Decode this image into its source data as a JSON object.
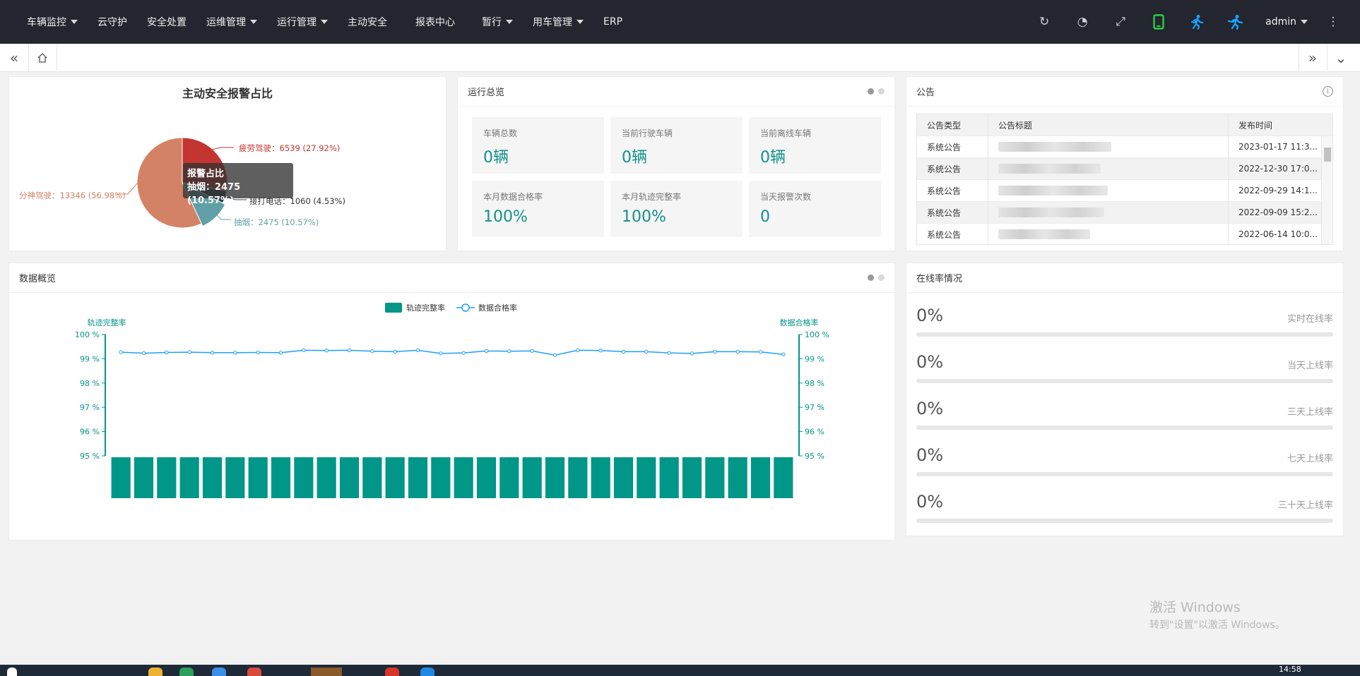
{
  "nav": {
    "menu": [
      {
        "label": "车辆监控",
        "dropdown": true
      },
      {
        "label": "云守护",
        "dropdown": false
      },
      {
        "label": "安全处置",
        "dropdown": false
      },
      {
        "label": "运维管理",
        "dropdown": true
      },
      {
        "label": "运行管理",
        "dropdown": true
      },
      {
        "label": "主动安全",
        "dropdown": false
      },
      {
        "label": "报表中心",
        "dropdown": false
      },
      {
        "label": "暂行",
        "dropdown": true
      },
      {
        "label": "用车管理",
        "dropdown": true
      },
      {
        "label": "ERP",
        "dropdown": false
      }
    ],
    "tools": [
      "refresh-icon",
      "dashboard-icon",
      "fullscreen-icon",
      "mobile-icon",
      "runner-icon",
      "runner-alt-icon"
    ],
    "user": "admin",
    "colors": {
      "bar": "#23262e",
      "mobile": "#2ecc40",
      "runner": "#1e9fff"
    }
  },
  "pie": {
    "title": "主动安全报警占比",
    "tooltip": {
      "title": "报警占比",
      "line": "抽烟：2475 (10.57%)"
    },
    "slices": [
      {
        "name": "疲劳驾驶",
        "value": 6539,
        "label": "疲劳驾驶：6539 (27.92%)",
        "color": "#c23531"
      },
      {
        "name": "接打电话",
        "value": 1060,
        "label": "接打电话：1060 (4.53%)",
        "color": "#2f4554"
      },
      {
        "name": "抽烟",
        "value": 2475,
        "label": "抽烟：2475 (10.57%)",
        "color": "#61a0a8"
      },
      {
        "name": "分神驾驶",
        "value": 13346,
        "label": "分神驾驶：13346 (56.98%)",
        "color": "#d48265"
      }
    ]
  },
  "overview": {
    "title": "运行总览",
    "stats": [
      {
        "label": "车辆总数",
        "value": "0辆"
      },
      {
        "label": "当前行驶车辆",
        "value": "0辆"
      },
      {
        "label": "当前离线车辆",
        "value": "0辆"
      },
      {
        "label": "本月数据合格率",
        "value": "100%"
      },
      {
        "label": "本月轨迹完整率",
        "value": "100%"
      },
      {
        "label": "当天报警次数",
        "value": "0"
      }
    ]
  },
  "notice": {
    "title": "公告",
    "columns": [
      "公告类型",
      "公告标题",
      "发布时间"
    ],
    "rows": [
      {
        "type": "系统公告",
        "time": "2023-01-17 11:3..."
      },
      {
        "type": "系统公告",
        "time": "2022-12-30 17:0..."
      },
      {
        "type": "系统公告",
        "time": "2022-09-29 14:1..."
      },
      {
        "type": "系统公告",
        "time": "2022-09-09 15:2..."
      },
      {
        "type": "系统公告",
        "time": "2022-06-14 10:0..."
      }
    ]
  },
  "data_overview": {
    "title": "数据概览"
  },
  "chart_data": {
    "type": "bar",
    "legend": [
      "轨迹完整率",
      "数据合格率"
    ],
    "legend_position": "top-center",
    "ylabel_left": "轨迹完整率",
    "ylabel_right": "数据合格率",
    "yticks": [
      "95 %",
      "96 %",
      "97 %",
      "98 %",
      "99 %",
      "100 %"
    ],
    "ylim": [
      95,
      100
    ],
    "series": [
      {
        "name": "轨迹完整率",
        "type": "bar",
        "color": "#009688",
        "values": [
          100,
          100,
          100,
          100,
          100,
          100,
          100,
          100,
          100,
          100,
          100,
          100,
          100,
          100,
          100,
          100,
          100,
          100,
          100,
          100,
          100,
          100,
          100,
          100,
          100,
          100,
          100,
          100,
          100,
          100
        ]
      },
      {
        "name": "数据合格率",
        "type": "line",
        "color": "#1e9fff",
        "values": [
          99.27,
          99.23,
          99.26,
          99.27,
          99.25,
          99.25,
          99.26,
          99.25,
          99.35,
          99.34,
          99.35,
          99.31,
          99.29,
          99.35,
          99.22,
          99.24,
          99.32,
          99.31,
          99.32,
          99.15,
          99.35,
          99.34,
          99.29,
          99.29,
          99.24,
          99.22,
          99.29,
          99.29,
          99.28,
          99.18
        ]
      }
    ]
  },
  "online": {
    "title": "在线率情况",
    "rows": [
      {
        "value": "0%",
        "label": "实时在线率",
        "fraction": 0
      },
      {
        "value": "0%",
        "label": "当天上线率",
        "fraction": 0
      },
      {
        "value": "0%",
        "label": "三天上线率",
        "fraction": 0
      },
      {
        "value": "0%",
        "label": "七天上线率",
        "fraction": 0
      },
      {
        "value": "0%",
        "label": "三十天上线率",
        "fraction": 0
      }
    ]
  },
  "watermark": {
    "line1": "激活 Windows",
    "line2": "转到\"设置\"以激活 Windows。"
  },
  "taskbar": {
    "time": "14:58"
  }
}
